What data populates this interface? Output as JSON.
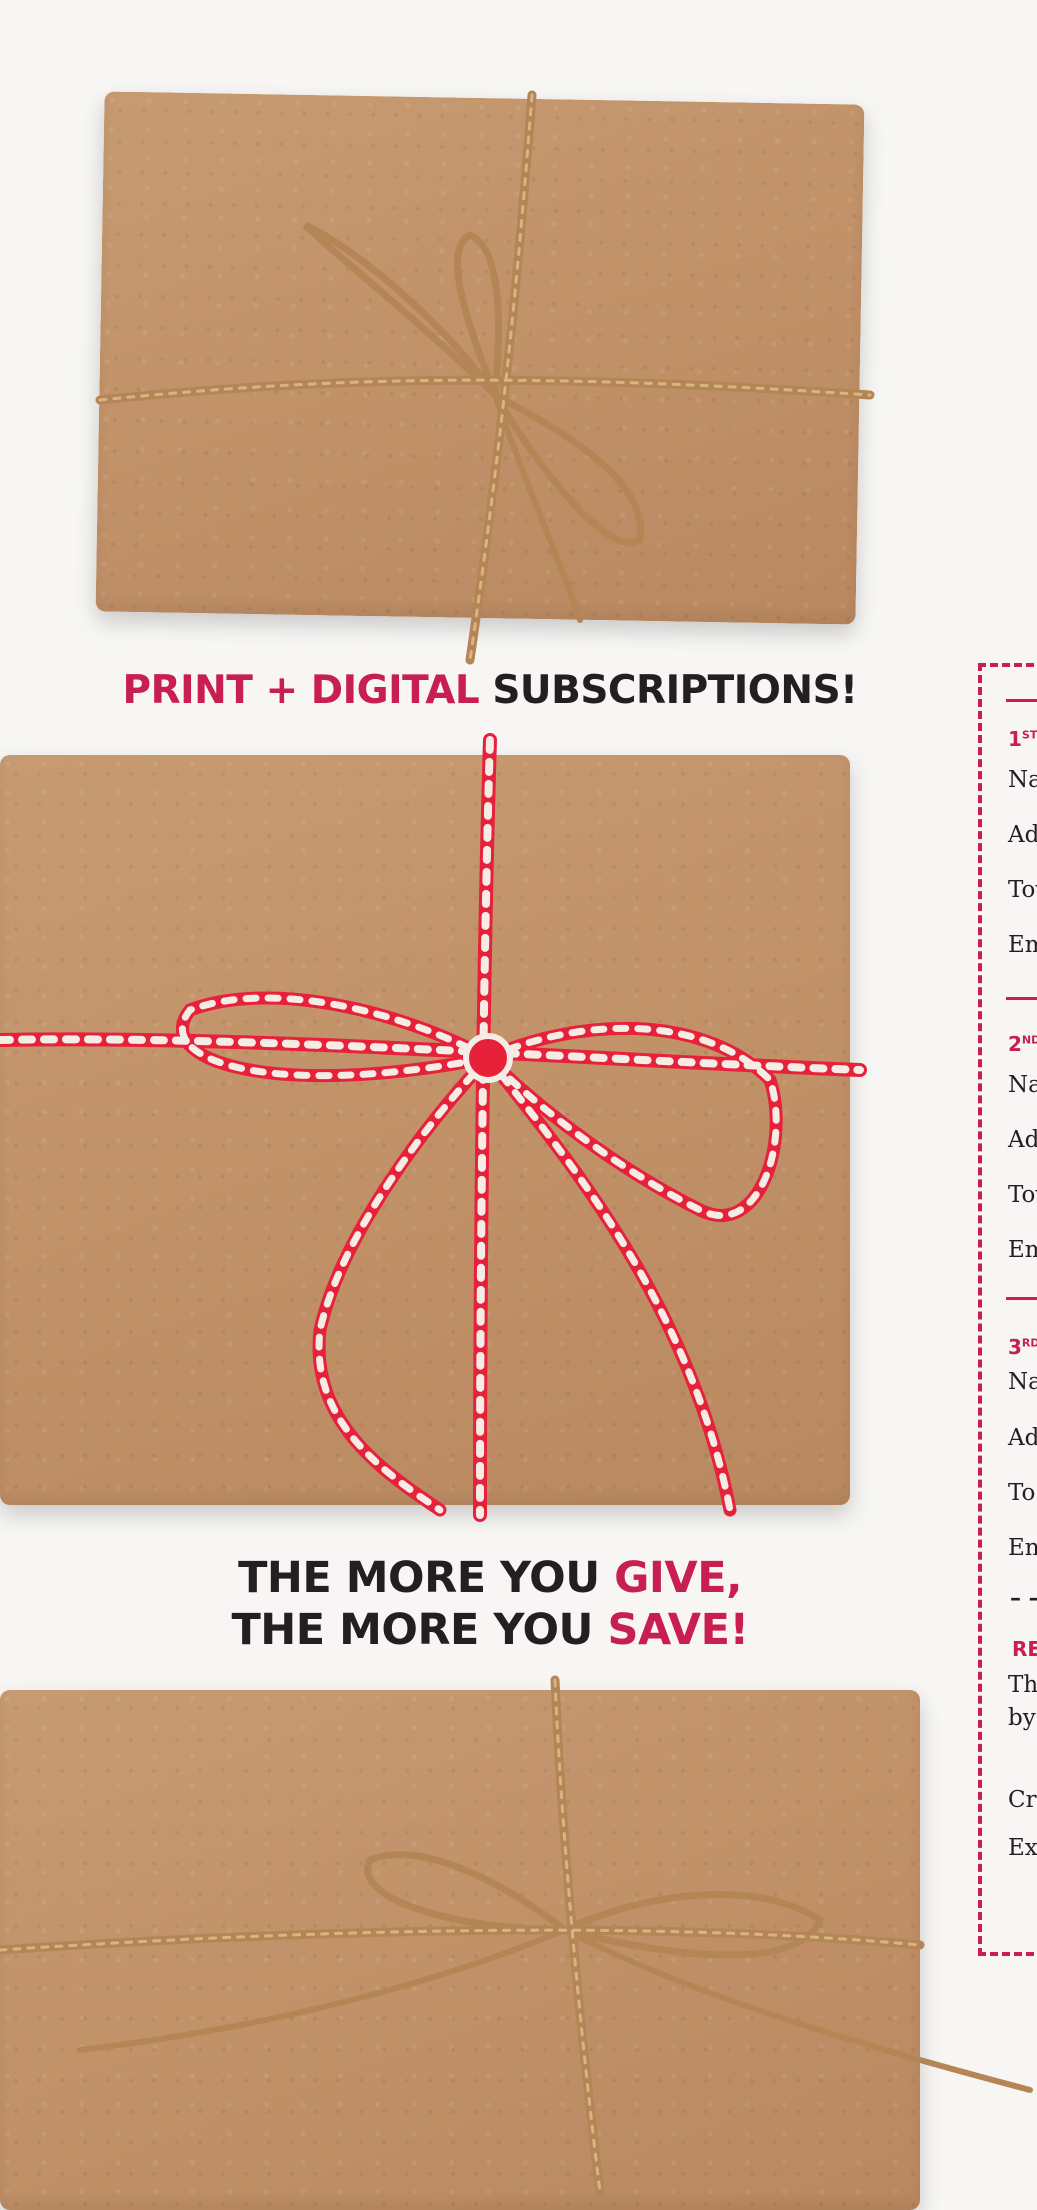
{
  "headline_top": {
    "part1": "PRINT + DIGITAL",
    "part2": "SUBSCRIPTIONS!"
  },
  "headline_bottom": {
    "line1_a": "THE MORE YOU",
    "line1_b": "GIVE,",
    "line2_a": "THE MORE YOU",
    "line2_b": "SAVE!"
  },
  "form": {
    "gift1": {
      "num": "1",
      "sup": "ST",
      "fields": [
        "Na",
        "Ad",
        "Tov",
        "Em"
      ]
    },
    "gift2": {
      "num": "2",
      "sup": "ND",
      "fields": [
        "Na",
        "Ad",
        "Tov",
        "Em"
      ]
    },
    "gift3": {
      "num": "3",
      "sup": "RD",
      "fields": [
        "Na",
        "Ad",
        "To",
        "En"
      ]
    },
    "dash": "– –",
    "re_label": "RE",
    "text_lines": [
      "Th",
      "by"
    ],
    "payment_fields": [
      "Cre",
      "Exp"
    ]
  },
  "colors": {
    "accent": "#c81e50",
    "text": "#231f20",
    "kraft": "#c29269",
    "twine": "#b98a55"
  }
}
